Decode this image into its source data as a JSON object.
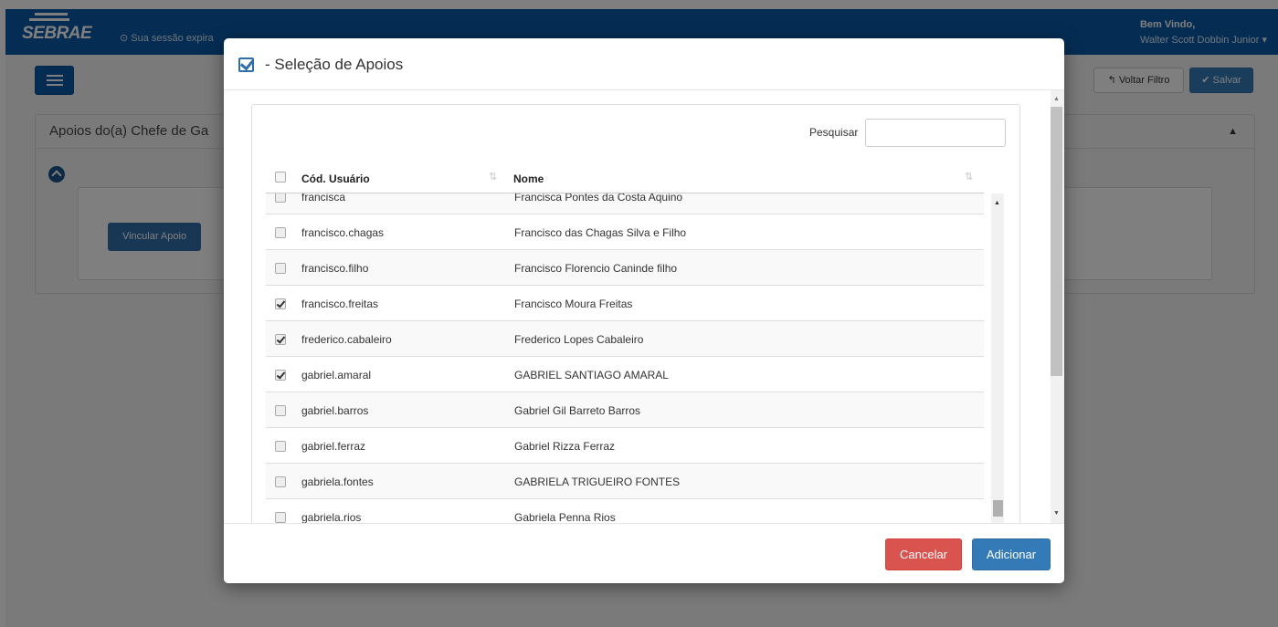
{
  "header": {
    "logo_text": "SEBRAE",
    "session_text": "Sua sessão expira",
    "welcome": "Bem Vindo,",
    "user_name": "Walter Scott Dobbin Junior"
  },
  "toolbar": {
    "voltar_label": "Voltar Filtro",
    "salvar_label": "Salvar"
  },
  "panel": {
    "title": "Apoios do(a) Chefe de Ga",
    "vincular_label": "Vincular Apoio"
  },
  "modal": {
    "title": "- Seleção de Apoios",
    "search_label": "Pesquisar",
    "search_value": "",
    "columns": [
      "Cód. Usuário",
      "Nome"
    ],
    "rows": [
      {
        "cod": "francisca",
        "nome": "Francisca Pontes da Costa Aquino",
        "checked": false
      },
      {
        "cod": "francisco.chagas",
        "nome": "Francisco das Chagas Silva e Filho",
        "checked": false
      },
      {
        "cod": "francisco.filho",
        "nome": "Francisco Florencio Caninde filho",
        "checked": false
      },
      {
        "cod": "francisco.freitas",
        "nome": "Francisco Moura Freitas",
        "checked": true
      },
      {
        "cod": "frederico.cabaleiro",
        "nome": "Frederico Lopes Cabaleiro",
        "checked": true
      },
      {
        "cod": "gabriel.amaral",
        "nome": "GABRIEL SANTIAGO AMARAL",
        "checked": true
      },
      {
        "cod": "gabriel.barros",
        "nome": "Gabriel Gil Barreto Barros",
        "checked": false
      },
      {
        "cod": "gabriel.ferraz",
        "nome": "Gabriel Rizza Ferraz",
        "checked": false
      },
      {
        "cod": "gabriela.fontes",
        "nome": "GABRIELA TRIGUEIRO FONTES",
        "checked": false
      },
      {
        "cod": "gabriela.rios",
        "nome": "Gabriela Penna Rios",
        "checked": false
      }
    ],
    "cancel_label": "Cancelar",
    "add_label": "Adicionar"
  },
  "colors": {
    "brand_blue": "#0a5aa8",
    "primary": "#337ab7",
    "danger": "#d9534f"
  }
}
